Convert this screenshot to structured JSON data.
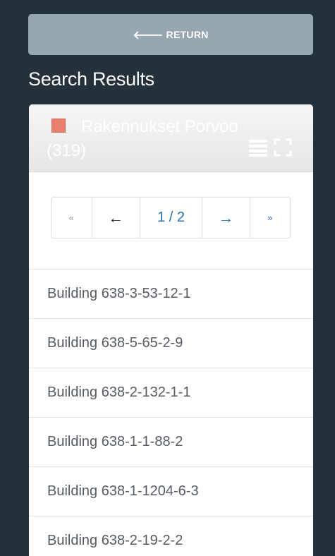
{
  "return_button": {
    "icon": "arrow-left-icon",
    "arrow": "🡐",
    "label": "RETURN"
  },
  "title": "Search Results",
  "layer": {
    "swatch_color": "#e9806f",
    "name": "Rakennukset Porvoo",
    "count": "(319)"
  },
  "pagination": {
    "first": "«",
    "prev": "←",
    "page": "1 / 2",
    "next": "→",
    "last": "»"
  },
  "results": [
    "Building 638-3-53-12-1",
    "Building 638-5-65-2-9",
    "Building 638-2-132-1-1",
    "Building 638-1-1-88-2",
    "Building 638-1-1204-6-3",
    "Building 638-2-19-2-2"
  ]
}
